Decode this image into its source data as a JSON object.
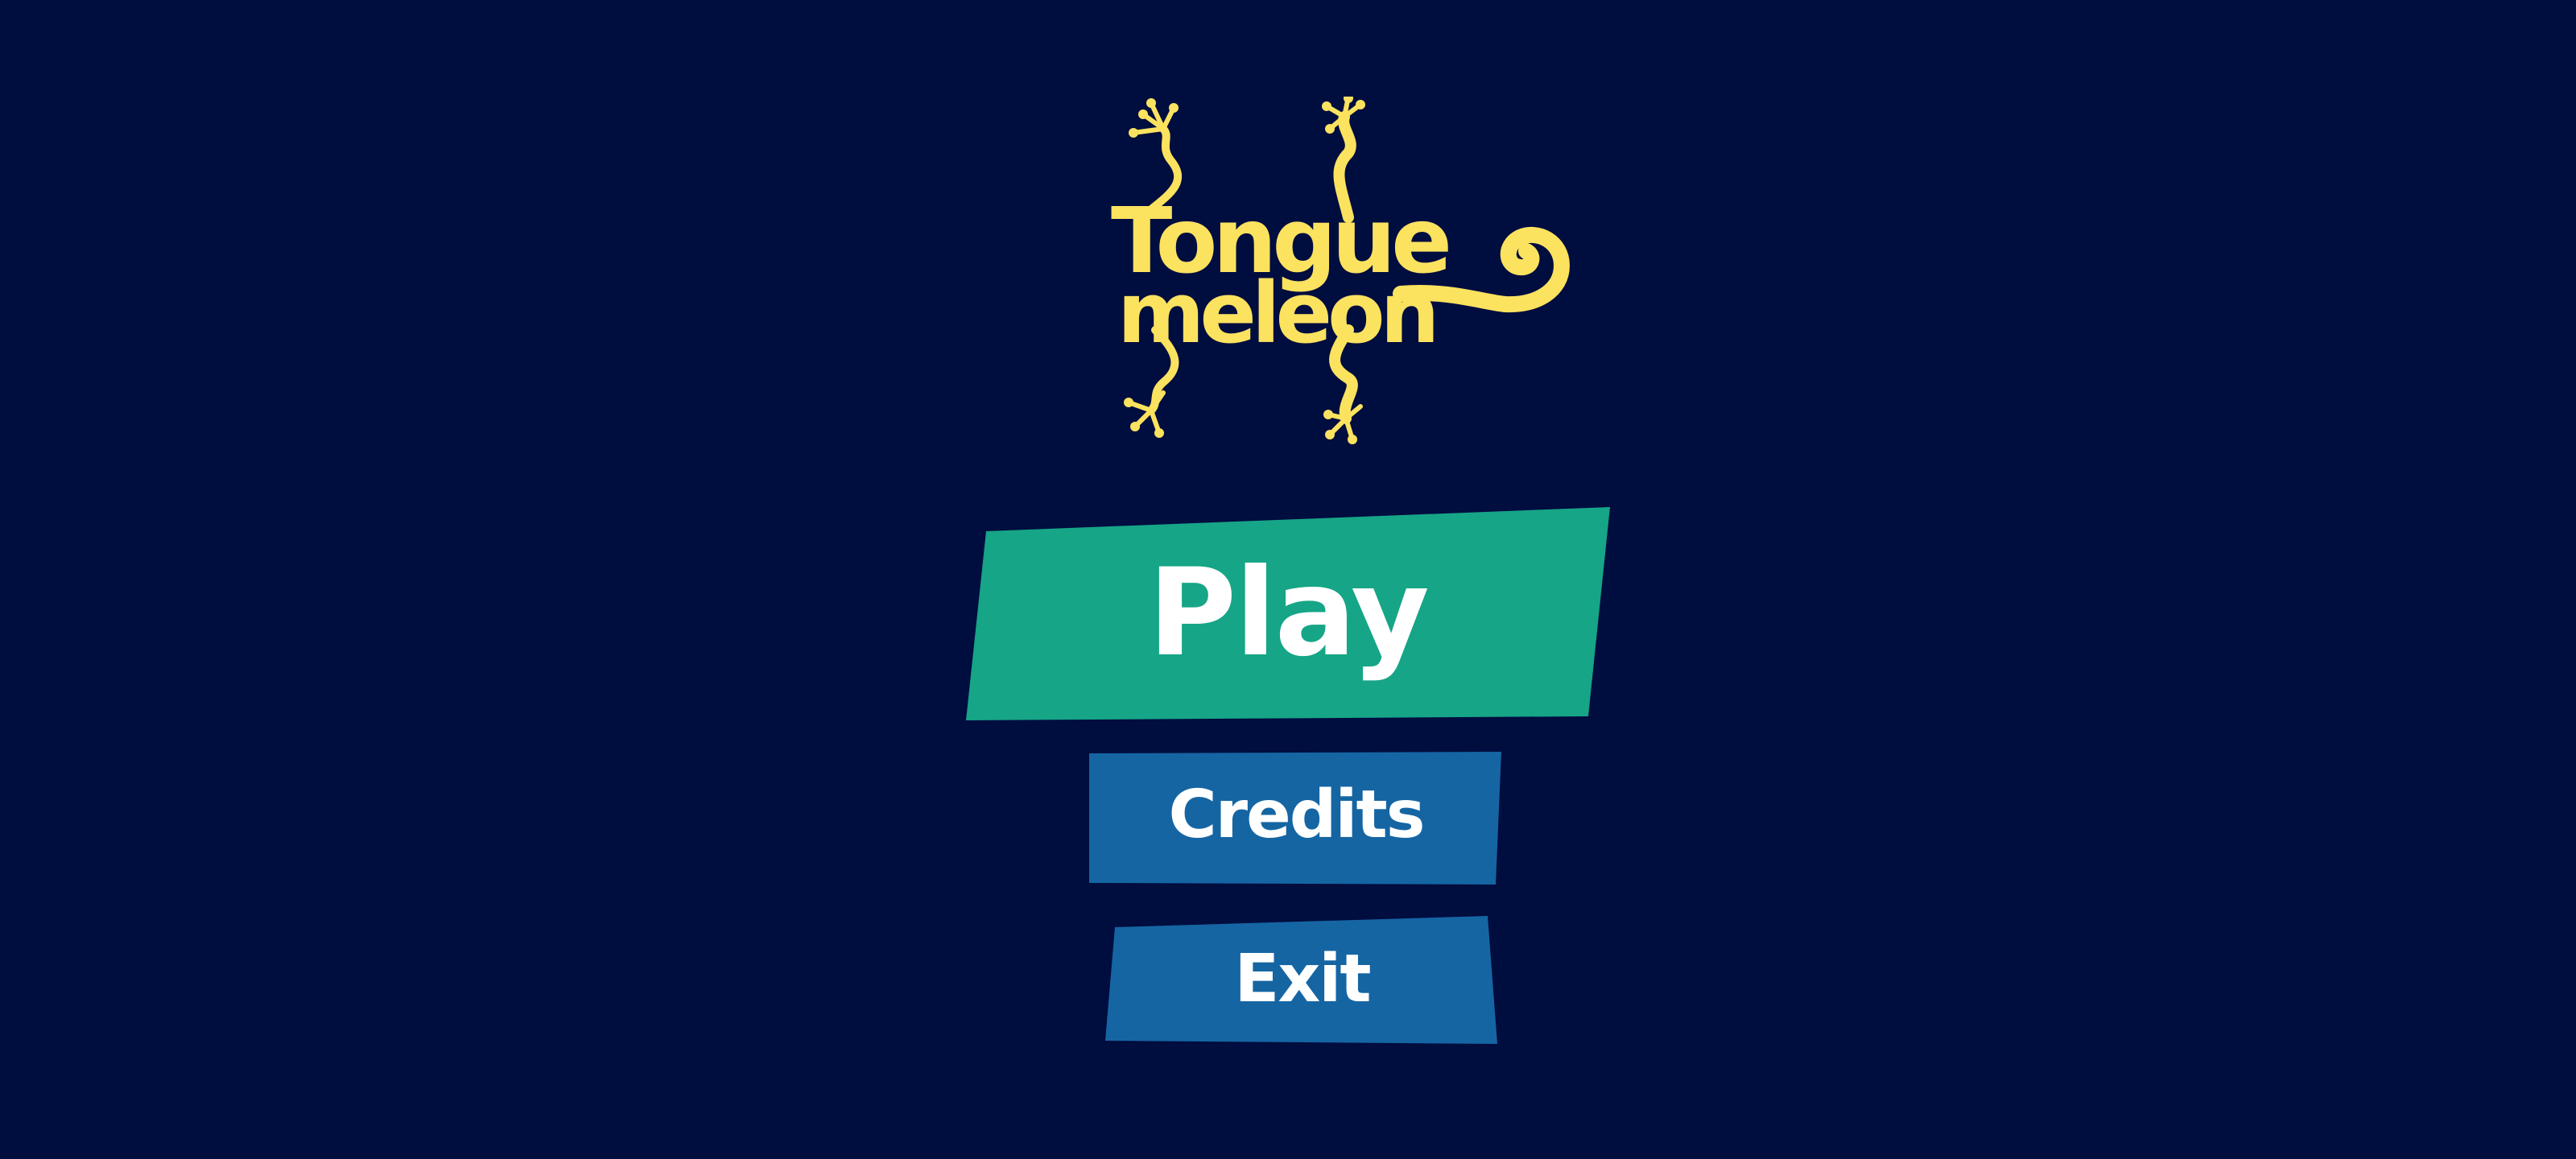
{
  "logo": {
    "title_line1": "Tongue",
    "title_line2": "meleon",
    "icon": "chameleon-logo-icon",
    "color": "#fbe25f"
  },
  "menu": {
    "play_label": "Play",
    "credits_label": "Credits",
    "exit_label": "Exit"
  },
  "colors": {
    "background": "#000d3f",
    "play_button": "#16a587",
    "secondary_button": "#1565a3",
    "button_text": "#ffffff"
  }
}
